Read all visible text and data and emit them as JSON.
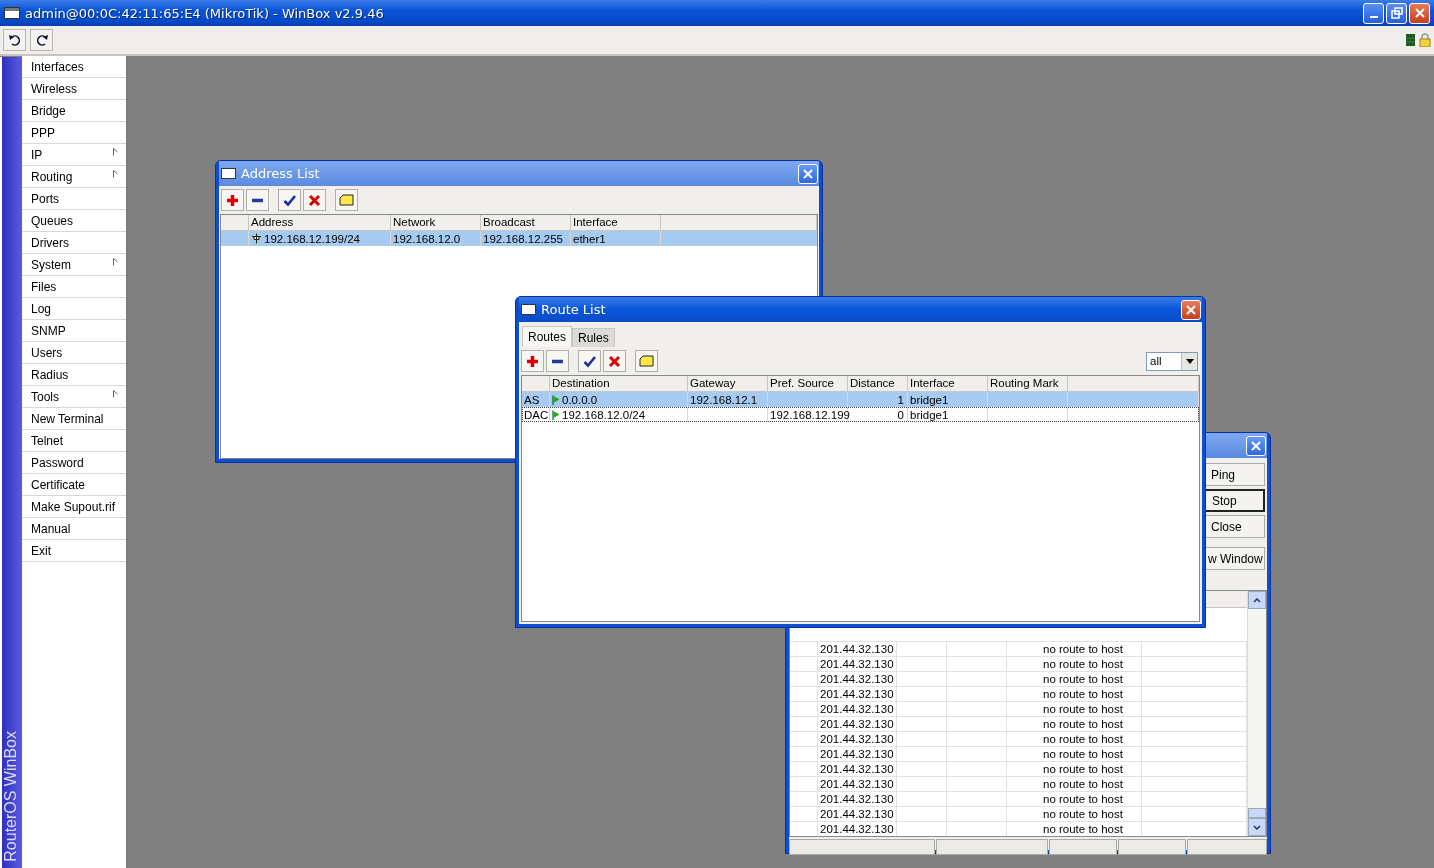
{
  "window": {
    "title": "admin@00:0C:42:11:65:E4 (MikroTik) - WinBox v2.9.46"
  },
  "brand": "RouterOS WinBox",
  "menu": [
    {
      "label": "Interfaces",
      "submenu": false
    },
    {
      "label": "Wireless",
      "submenu": false
    },
    {
      "label": "Bridge",
      "submenu": false
    },
    {
      "label": "PPP",
      "submenu": false
    },
    {
      "label": "IP",
      "submenu": true
    },
    {
      "label": "Routing",
      "submenu": true
    },
    {
      "label": "Ports",
      "submenu": false
    },
    {
      "label": "Queues",
      "submenu": false
    },
    {
      "label": "Drivers",
      "submenu": false
    },
    {
      "label": "System",
      "submenu": true
    },
    {
      "label": "Files",
      "submenu": false
    },
    {
      "label": "Log",
      "submenu": false
    },
    {
      "label": "SNMP",
      "submenu": false
    },
    {
      "label": "Users",
      "submenu": false
    },
    {
      "label": "Radius",
      "submenu": false
    },
    {
      "label": "Tools",
      "submenu": true
    },
    {
      "label": "New Terminal",
      "submenu": false
    },
    {
      "label": "Telnet",
      "submenu": false
    },
    {
      "label": "Password",
      "submenu": false
    },
    {
      "label": "Certificate",
      "submenu": false
    },
    {
      "label": "Make Supout.rif",
      "submenu": false
    },
    {
      "label": "Manual",
      "submenu": false
    },
    {
      "label": "Exit",
      "submenu": false
    }
  ],
  "address_list": {
    "title": "Address List",
    "columns": [
      "Address",
      "Network",
      "Broadcast",
      "Interface"
    ],
    "rows": [
      {
        "address": "192.168.12.199/24",
        "network": "192.168.12.0",
        "broadcast": "192.168.12.255",
        "interface": "ether1",
        "selected": true
      }
    ]
  },
  "ping_window": {
    "buttons": [
      {
        "label": "Ping",
        "focused": false
      },
      {
        "label": "Stop",
        "focused": true
      },
      {
        "label": "Close",
        "focused": false
      },
      {
        "label": "w Window",
        "focused": false
      }
    ],
    "rows": [
      {
        "host": "201.44.32.130",
        "status": "no route to host"
      },
      {
        "host": "201.44.32.130",
        "status": "no route to host"
      },
      {
        "host": "201.44.32.130",
        "status": "no route to host"
      },
      {
        "host": "201.44.32.130",
        "status": "no route to host"
      },
      {
        "host": "201.44.32.130",
        "status": "no route to host"
      },
      {
        "host": "201.44.32.130",
        "status": "no route to host"
      },
      {
        "host": "201.44.32.130",
        "status": "no route to host"
      },
      {
        "host": "201.44.32.130",
        "status": "no route to host"
      },
      {
        "host": "201.44.32.130",
        "status": "no route to host"
      },
      {
        "host": "201.44.32.130",
        "status": "no route to host"
      },
      {
        "host": "201.44.32.130",
        "status": "no route to host"
      },
      {
        "host": "201.44.32.130",
        "status": "no route to host"
      },
      {
        "host": "201.44.32.130",
        "status": "no route to host"
      }
    ]
  },
  "route_list": {
    "title": "Route List",
    "tabs": [
      {
        "label": "Routes",
        "selected": true
      },
      {
        "label": "Rules",
        "selected": false
      }
    ],
    "filter": "all",
    "columns": [
      "Destination",
      "Gateway",
      "Pref. Source",
      "Distance",
      "Interface",
      "Routing Mark"
    ],
    "rows": [
      {
        "flags": "AS",
        "destination": "0.0.0.0",
        "gateway": "192.168.12.1",
        "distance": "1",
        "interface": "bridge1",
        "selected": true
      },
      {
        "flags": "DAC",
        "destination": "192.168.12.0/24",
        "pref_source": "192.168.12.199",
        "distance": "0",
        "interface": "bridge1",
        "selected": false
      }
    ]
  }
}
